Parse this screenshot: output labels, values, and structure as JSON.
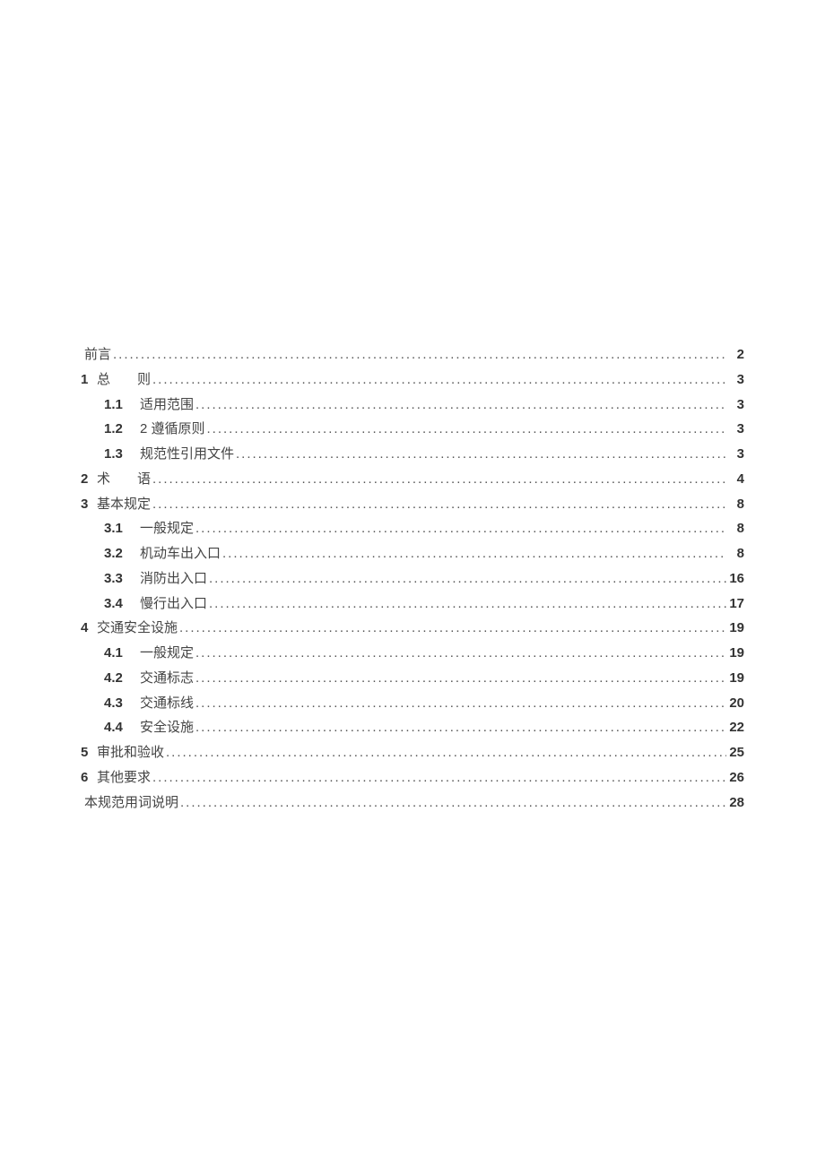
{
  "toc": [
    {
      "level": 0,
      "num": "",
      "title": "前言",
      "page": "2"
    },
    {
      "level": 0,
      "num": "1",
      "title": "总　　则",
      "page": "3"
    },
    {
      "level": 1,
      "num": "1.1",
      "title": "适用范围",
      "page": "3"
    },
    {
      "level": 1,
      "num": "1.2",
      "title": "2 遵循原则",
      "page": "3"
    },
    {
      "level": 1,
      "num": "1.3",
      "title": "规范性引用文件",
      "page": "3"
    },
    {
      "level": 0,
      "num": "2",
      "title": "术　　语",
      "page": "4"
    },
    {
      "level": 0,
      "num": "3",
      "title": "基本规定",
      "page": "8"
    },
    {
      "level": 1,
      "num": "3.1",
      "title": "一般规定",
      "page": "8"
    },
    {
      "level": 1,
      "num": "3.2",
      "title": "机动车出入口",
      "page": "8"
    },
    {
      "level": 1,
      "num": "3.3",
      "title": "消防出入口",
      "page": "16"
    },
    {
      "level": 1,
      "num": "3.4",
      "title": "慢行出入口",
      "page": "17"
    },
    {
      "level": 0,
      "num": "4",
      "title": "交通安全设施",
      "page": "19"
    },
    {
      "level": 1,
      "num": "4.1",
      "title": "一般规定",
      "page": "19"
    },
    {
      "level": 1,
      "num": "4.2",
      "title": "交通标志",
      "page": "19"
    },
    {
      "level": 1,
      "num": "4.3",
      "title": "交通标线",
      "page": "20"
    },
    {
      "level": 1,
      "num": "4.4",
      "title": "安全设施",
      "page": "22"
    },
    {
      "level": 0,
      "num": "5",
      "title": "审批和验收",
      "page": "25"
    },
    {
      "level": 0,
      "num": "6",
      "title": "其他要求",
      "page": "26"
    },
    {
      "level": 0,
      "num": "",
      "title": "本规范用词说明",
      "page": "28"
    }
  ]
}
